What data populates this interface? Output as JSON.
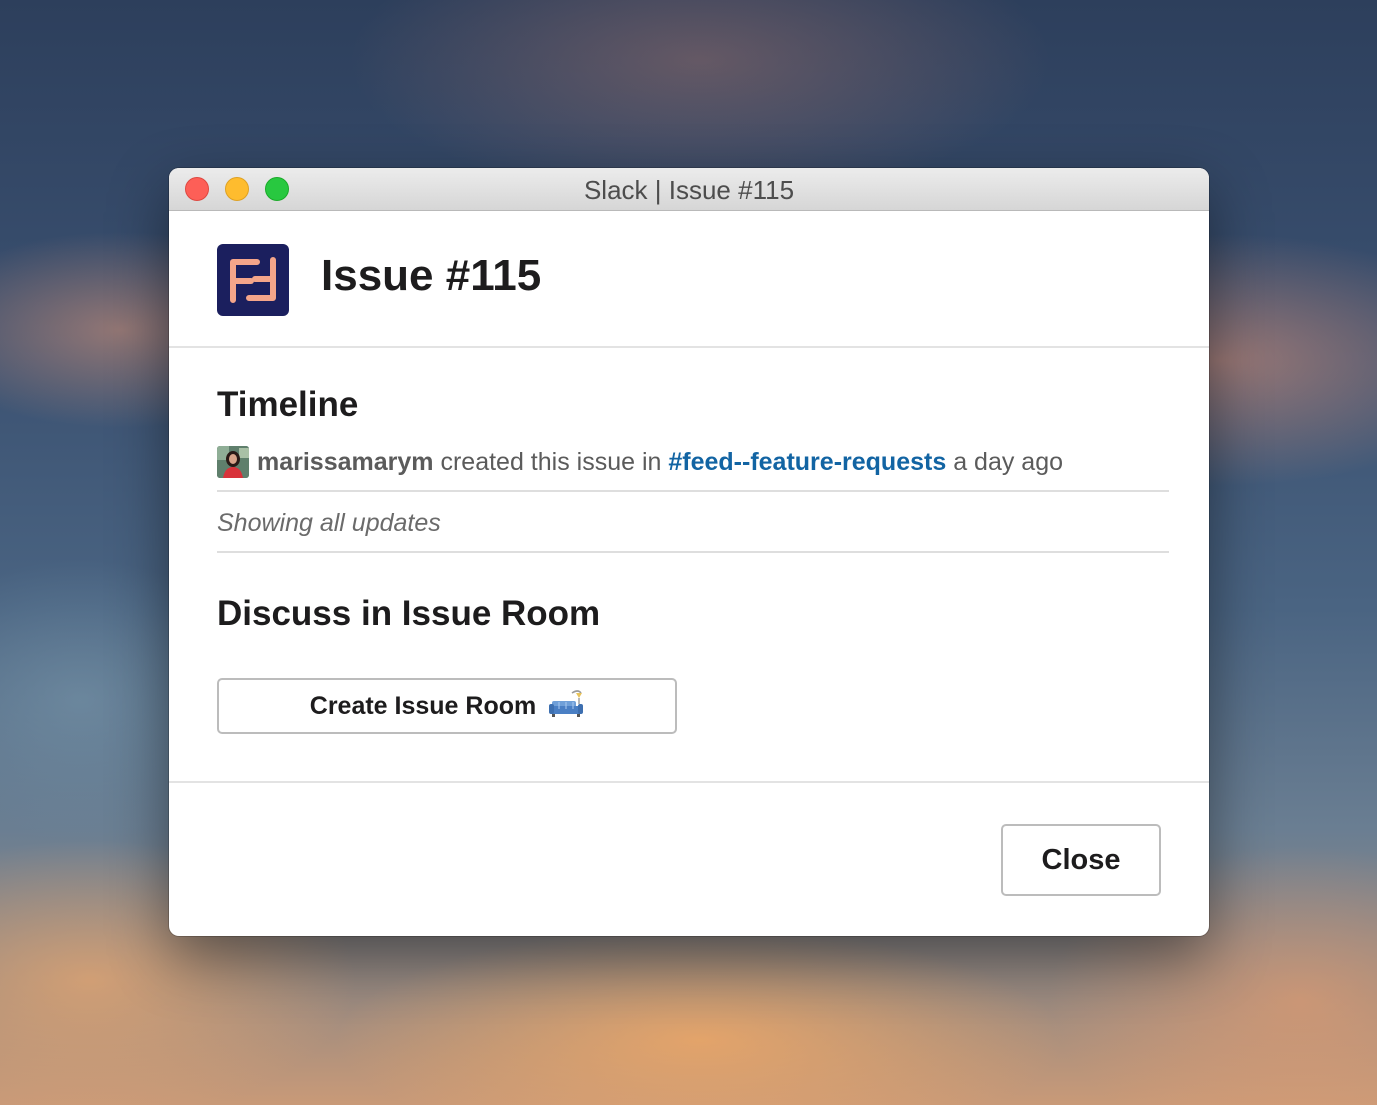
{
  "window": {
    "title": "Slack | Issue #115"
  },
  "modal": {
    "title": "Issue #115",
    "app_logo_icon": "app-logo-icon",
    "colors": {
      "logo_background": "#1b1f5e",
      "logo_mark": "#f4a58a",
      "link": "#1264a3"
    }
  },
  "timeline": {
    "heading": "Timeline",
    "entry": {
      "user": "marissamarym",
      "action": "created this issue in",
      "channel": "#feed--feature-requests",
      "time": "a day ago"
    },
    "updates_note": "Showing all updates"
  },
  "discuss": {
    "heading": "Discuss in Issue Room",
    "button_label": "Create Issue Room",
    "button_emoji": "couch-and-lamp-icon"
  },
  "footer": {
    "close_label": "Close"
  }
}
